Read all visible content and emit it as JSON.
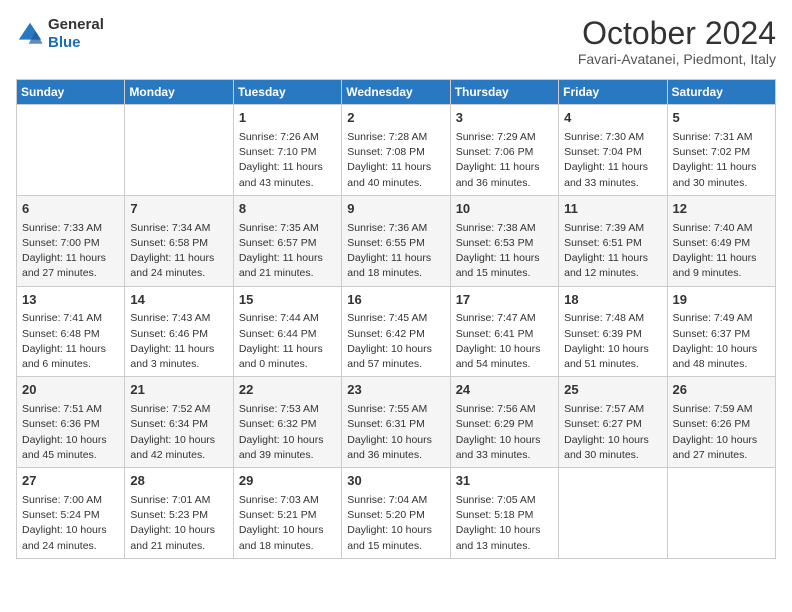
{
  "header": {
    "logo_line1": "General",
    "logo_line2": "Blue",
    "month": "October 2024",
    "location": "Favari-Avatanei, Piedmont, Italy"
  },
  "weekdays": [
    "Sunday",
    "Monday",
    "Tuesday",
    "Wednesday",
    "Thursday",
    "Friday",
    "Saturday"
  ],
  "weeks": [
    [
      {
        "day": "",
        "info": ""
      },
      {
        "day": "",
        "info": ""
      },
      {
        "day": "1",
        "info": "Sunrise: 7:26 AM\nSunset: 7:10 PM\nDaylight: 11 hours and 43 minutes."
      },
      {
        "day": "2",
        "info": "Sunrise: 7:28 AM\nSunset: 7:08 PM\nDaylight: 11 hours and 40 minutes."
      },
      {
        "day": "3",
        "info": "Sunrise: 7:29 AM\nSunset: 7:06 PM\nDaylight: 11 hours and 36 minutes."
      },
      {
        "day": "4",
        "info": "Sunrise: 7:30 AM\nSunset: 7:04 PM\nDaylight: 11 hours and 33 minutes."
      },
      {
        "day": "5",
        "info": "Sunrise: 7:31 AM\nSunset: 7:02 PM\nDaylight: 11 hours and 30 minutes."
      }
    ],
    [
      {
        "day": "6",
        "info": "Sunrise: 7:33 AM\nSunset: 7:00 PM\nDaylight: 11 hours and 27 minutes."
      },
      {
        "day": "7",
        "info": "Sunrise: 7:34 AM\nSunset: 6:58 PM\nDaylight: 11 hours and 24 minutes."
      },
      {
        "day": "8",
        "info": "Sunrise: 7:35 AM\nSunset: 6:57 PM\nDaylight: 11 hours and 21 minutes."
      },
      {
        "day": "9",
        "info": "Sunrise: 7:36 AM\nSunset: 6:55 PM\nDaylight: 11 hours and 18 minutes."
      },
      {
        "day": "10",
        "info": "Sunrise: 7:38 AM\nSunset: 6:53 PM\nDaylight: 11 hours and 15 minutes."
      },
      {
        "day": "11",
        "info": "Sunrise: 7:39 AM\nSunset: 6:51 PM\nDaylight: 11 hours and 12 minutes."
      },
      {
        "day": "12",
        "info": "Sunrise: 7:40 AM\nSunset: 6:49 PM\nDaylight: 11 hours and 9 minutes."
      }
    ],
    [
      {
        "day": "13",
        "info": "Sunrise: 7:41 AM\nSunset: 6:48 PM\nDaylight: 11 hours and 6 minutes."
      },
      {
        "day": "14",
        "info": "Sunrise: 7:43 AM\nSunset: 6:46 PM\nDaylight: 11 hours and 3 minutes."
      },
      {
        "day": "15",
        "info": "Sunrise: 7:44 AM\nSunset: 6:44 PM\nDaylight: 11 hours and 0 minutes."
      },
      {
        "day": "16",
        "info": "Sunrise: 7:45 AM\nSunset: 6:42 PM\nDaylight: 10 hours and 57 minutes."
      },
      {
        "day": "17",
        "info": "Sunrise: 7:47 AM\nSunset: 6:41 PM\nDaylight: 10 hours and 54 minutes."
      },
      {
        "day": "18",
        "info": "Sunrise: 7:48 AM\nSunset: 6:39 PM\nDaylight: 10 hours and 51 minutes."
      },
      {
        "day": "19",
        "info": "Sunrise: 7:49 AM\nSunset: 6:37 PM\nDaylight: 10 hours and 48 minutes."
      }
    ],
    [
      {
        "day": "20",
        "info": "Sunrise: 7:51 AM\nSunset: 6:36 PM\nDaylight: 10 hours and 45 minutes."
      },
      {
        "day": "21",
        "info": "Sunrise: 7:52 AM\nSunset: 6:34 PM\nDaylight: 10 hours and 42 minutes."
      },
      {
        "day": "22",
        "info": "Sunrise: 7:53 AM\nSunset: 6:32 PM\nDaylight: 10 hours and 39 minutes."
      },
      {
        "day": "23",
        "info": "Sunrise: 7:55 AM\nSunset: 6:31 PM\nDaylight: 10 hours and 36 minutes."
      },
      {
        "day": "24",
        "info": "Sunrise: 7:56 AM\nSunset: 6:29 PM\nDaylight: 10 hours and 33 minutes."
      },
      {
        "day": "25",
        "info": "Sunrise: 7:57 AM\nSunset: 6:27 PM\nDaylight: 10 hours and 30 minutes."
      },
      {
        "day": "26",
        "info": "Sunrise: 7:59 AM\nSunset: 6:26 PM\nDaylight: 10 hours and 27 minutes."
      }
    ],
    [
      {
        "day": "27",
        "info": "Sunrise: 7:00 AM\nSunset: 5:24 PM\nDaylight: 10 hours and 24 minutes."
      },
      {
        "day": "28",
        "info": "Sunrise: 7:01 AM\nSunset: 5:23 PM\nDaylight: 10 hours and 21 minutes."
      },
      {
        "day": "29",
        "info": "Sunrise: 7:03 AM\nSunset: 5:21 PM\nDaylight: 10 hours and 18 minutes."
      },
      {
        "day": "30",
        "info": "Sunrise: 7:04 AM\nSunset: 5:20 PM\nDaylight: 10 hours and 15 minutes."
      },
      {
        "day": "31",
        "info": "Sunrise: 7:05 AM\nSunset: 5:18 PM\nDaylight: 10 hours and 13 minutes."
      },
      {
        "day": "",
        "info": ""
      },
      {
        "day": "",
        "info": ""
      }
    ]
  ]
}
